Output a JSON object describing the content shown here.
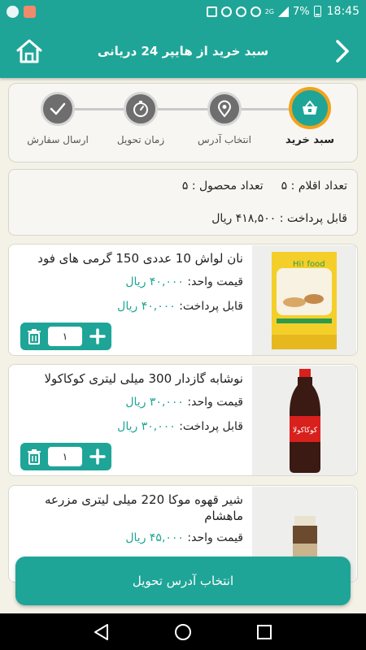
{
  "status_bar": {
    "network_label": "2G",
    "battery": "7%",
    "time": "18:45"
  },
  "header": {
    "title": "سبد خرید از هایپر 24 دریانی"
  },
  "stepper": {
    "steps": [
      {
        "label": "سبد خرید",
        "icon": "basket-icon",
        "active": true
      },
      {
        "label": "انتخاب آدرس",
        "icon": "location-pin-icon",
        "active": false
      },
      {
        "label": "زمان تحویل",
        "icon": "stopwatch-icon",
        "active": false
      },
      {
        "label": "ارسال سفارش",
        "icon": "check-icon",
        "active": false
      }
    ]
  },
  "summary": {
    "items_count": "تعداد اقلام : ۵",
    "products_count": "تعداد محصول : ۵",
    "payable": "قابل پرداخت : ۴۱۸,۵۰۰ ریال"
  },
  "products": [
    {
      "name": "نان لواش 10 عددی 150 گرمی های فود",
      "unit_price_label": "قیمت واحد:",
      "unit_price": "۴۰,۰۰۰ ریال",
      "payable_label": "قابل پرداخت:",
      "payable": "۴۰,۰۰۰ ریال",
      "quantity": "۱",
      "image_text": "Hi! food"
    },
    {
      "name": "نوشابه گازدار 300 میلی لیتری کوکاکولا",
      "unit_price_label": "قیمت واحد:",
      "unit_price": "۳۰,۰۰۰ ریال",
      "payable_label": "قابل پرداخت:",
      "payable": "۳۰,۰۰۰ ریال",
      "quantity": "۱",
      "image_text": "کوکاکولا"
    },
    {
      "name": "شیر قهوه موکا 220 میلی لیتری مزرعه ماهشام",
      "unit_price_label": "قیمت واحد:",
      "unit_price": "۴۵,۰۰۰ ریال"
    }
  ],
  "cta": {
    "label": "انتخاب آدرس تحویل"
  },
  "colors": {
    "primary": "#1ea597",
    "accent_ring": "#f3a21a",
    "background": "#f4f1e6"
  }
}
